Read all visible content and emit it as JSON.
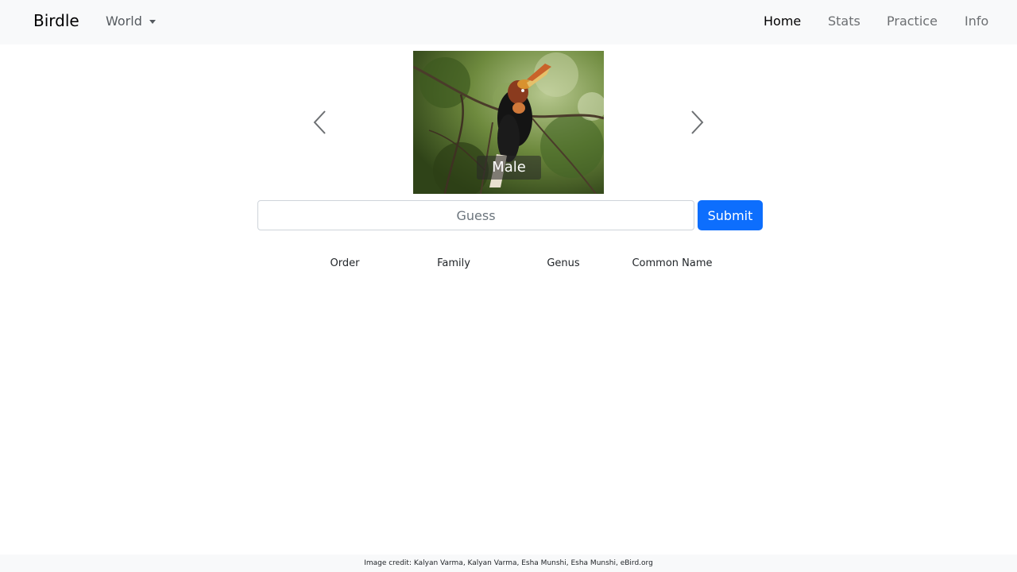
{
  "app": {
    "brand": "Birdle",
    "region": "World"
  },
  "nav": {
    "items": [
      {
        "label": "Home",
        "active": true
      },
      {
        "label": "Stats",
        "active": false
      },
      {
        "label": "Practice",
        "active": false
      },
      {
        "label": "Info",
        "active": false
      }
    ]
  },
  "carousel": {
    "caption": "Male",
    "prev_icon": "chevron-left-icon",
    "next_icon": "chevron-right-icon"
  },
  "guess": {
    "value": "",
    "placeholder": "Guess",
    "submit_label": "Submit"
  },
  "results": {
    "columns": [
      "Order",
      "Family",
      "Genus",
      "Common Name"
    ]
  },
  "footer": {
    "credit": "Image credit: Kalyan Varma, Kalyan Varma, Esha Munshi, Esha Munshi, eBird.org"
  },
  "colors": {
    "navbar_bg": "#f8f9fa",
    "primary": "#0d6efd",
    "caption_bg": "#282828"
  }
}
